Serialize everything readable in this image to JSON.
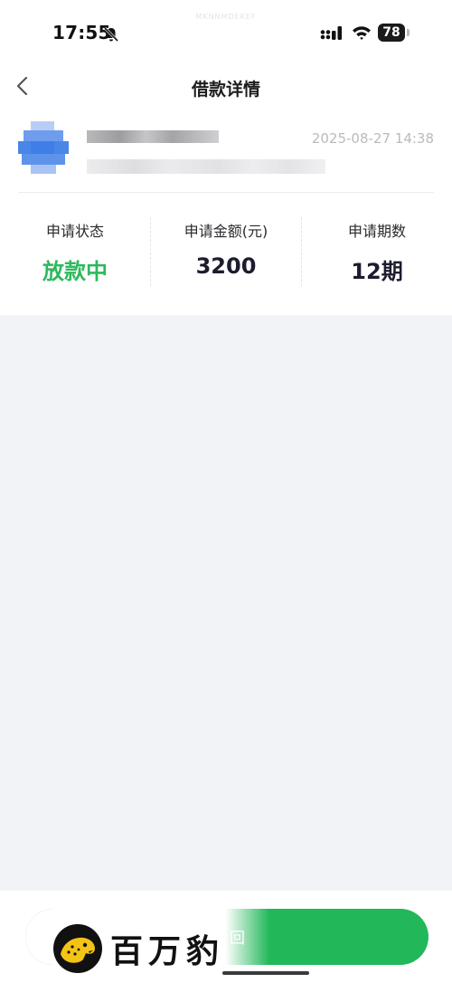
{
  "status_bar": {
    "time": "17:55",
    "watermark": "MKNNMDEKEF",
    "battery": "78"
  },
  "header": {
    "title": "借款详情"
  },
  "loan": {
    "timestamp": "2025-08-27 14:38",
    "stats": [
      {
        "label": "申请状态",
        "value": "放款中"
      },
      {
        "label": "申请金额(元)",
        "value": "3200"
      },
      {
        "label": "申请期数",
        "value": "12期"
      }
    ]
  },
  "bottom": {
    "button_label": "回",
    "logo_text": "百万豹"
  },
  "colors": {
    "accent_green": "#22b85a",
    "status_green": "#2db95c",
    "background": "#f2f3f7"
  },
  "icons": {
    "back": "chevron-left-icon",
    "bell": "bell-slash-icon",
    "signal": "signal-icon",
    "wifi": "wifi-icon",
    "logo": "leopard-logo-icon"
  }
}
